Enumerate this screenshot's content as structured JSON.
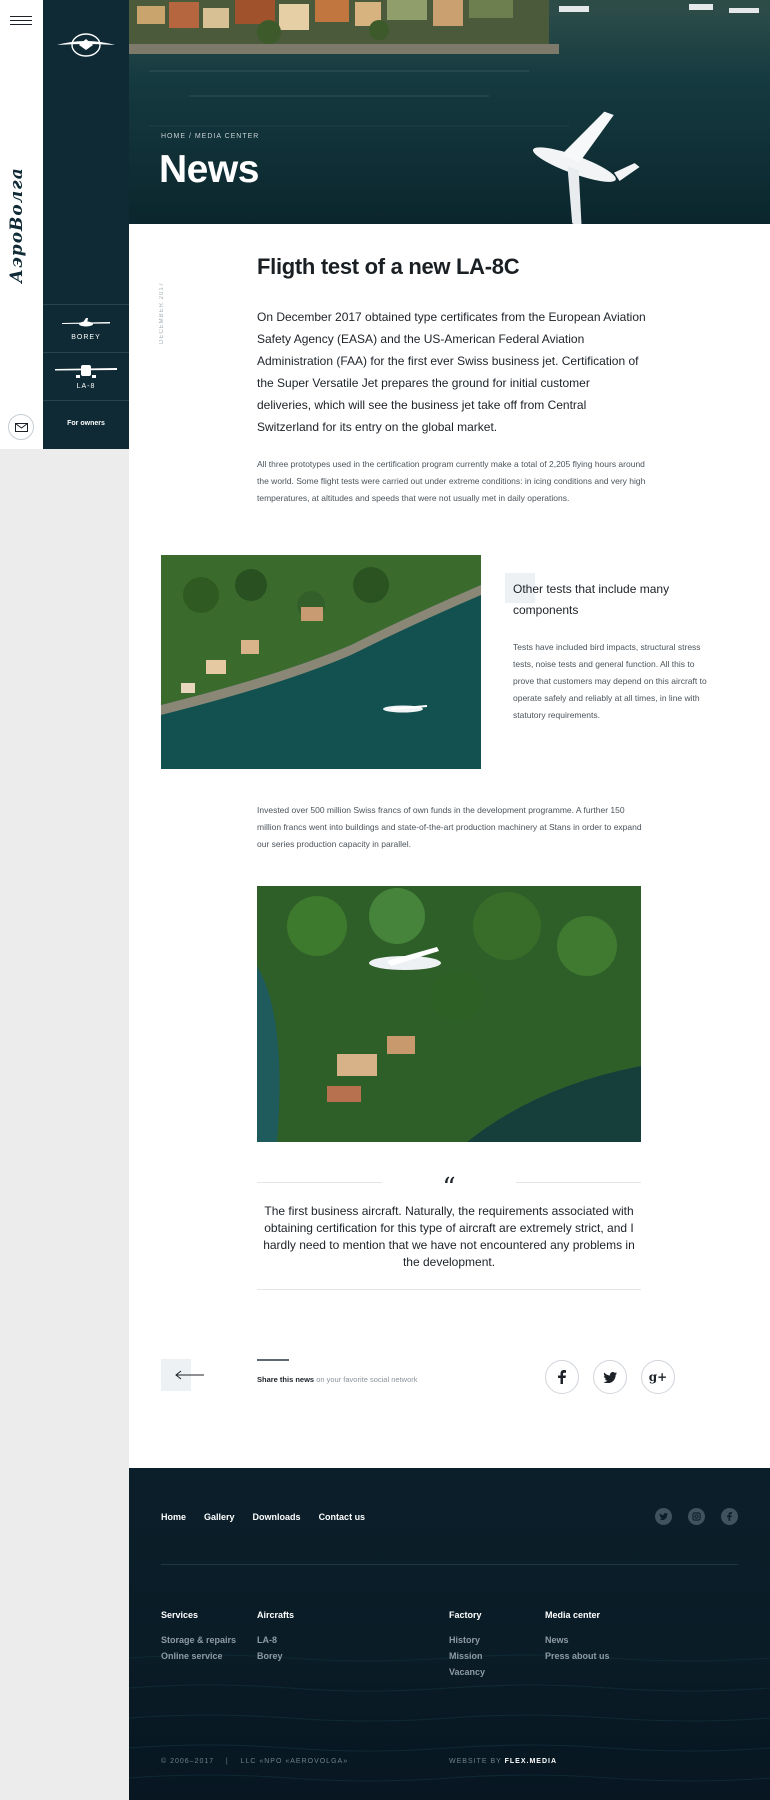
{
  "brand": {
    "name": "АэроВолга"
  },
  "sidebar": {
    "aircraft": [
      {
        "label": "BOREY"
      },
      {
        "label": "LA-8"
      }
    ],
    "owners_label": "For owners"
  },
  "hero": {
    "breadcrumb": [
      "HOME",
      "MEDIA CENTER"
    ],
    "breadcrumb_sep": " / ",
    "title": "News"
  },
  "article": {
    "date": "DECEMBER 2017",
    "title": "Fligth test of a new LA-8C",
    "lead": "On December 2017 obtained type certificates from the European Aviation Safety Agency (EASA) and the US-American Federal Aviation Administration (FAA) for the first ever Swiss business jet. Certification of the Super Versatile Jet prepares the ground for initial customer deliveries, which will see the business jet take off from Central Switzerland for its entry on the global market.",
    "p1": "All three prototypes used in the certification program currently make a total of 2,205 flying hours around the world. Some flight tests were carried out under extreme conditions: in icing conditions and very high temperatures, at altitudes and speeds that were not usually met in daily operations.",
    "side_title": "Other tests that include many components",
    "side_text": "Tests have included bird impacts, structural stress tests, noise tests and general function. All this to prove that customers may depend on this aircraft to operate safely and reliably at all times, in line with statutory requirements.",
    "p2": "Invested over 500 million Swiss francs of own funds in the development programme. A further 150 million francs went into buildings and state-of-the-art production machinery at Stans in order to expand our series production capacity in parallel.",
    "quote_mark": "“",
    "quote": "The first business aircraft. Naturally, the requirements associated with obtaining certification for this type of aircraft are extremely strict, and I hardly need to mention that we have not encountered any problems in the development."
  },
  "share": {
    "strong": "Share this news",
    "rest": " on your favorite social network",
    "networks": [
      "facebook-icon",
      "twitter-icon",
      "google-plus-icon"
    ],
    "google_label": "g+"
  },
  "footer": {
    "nav": [
      "Home",
      "Gallery",
      "Downloads",
      "Contact us"
    ],
    "columns": [
      {
        "title": "Services",
        "links": [
          "Storage & repairs",
          "Online service"
        ]
      },
      {
        "title": "Aircrafts",
        "links": [
          "LA-8",
          "Borey"
        ]
      },
      {
        "title": "Factory",
        "links": [
          "History",
          "Mission",
          "Vacancy"
        ]
      },
      {
        "title": "Media center",
        "links": [
          "News",
          "Press about us"
        ]
      }
    ],
    "copyright": "© 2006–2017",
    "company": "LLC «NPO «AEROVOLGA»",
    "made_by_prefix": "WEBSITE BY ",
    "made_by": "FLEX.MEDIA"
  },
  "colors": {
    "navy": "#0f2a35",
    "footer": "#0b1f2a",
    "light_bg": "#ececec"
  }
}
